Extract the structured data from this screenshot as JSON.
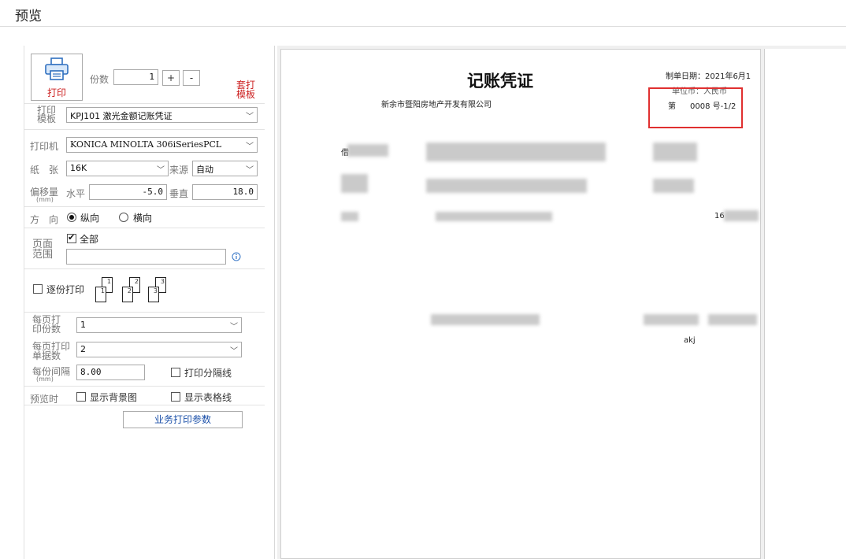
{
  "window": {
    "title": "预览"
  },
  "print_panel": {
    "print_button_label": "打印",
    "copies_label": "份数",
    "copies_value": "1",
    "plus_label": "+",
    "minus_label": "-",
    "template_stamp": "套打\n模板",
    "template_label": "打印\n模板",
    "template_value": "KPJ101 激光金额记账凭证",
    "printer_label": "打印机",
    "printer_value": "KONICA MINOLTA 306iSeriesPCL",
    "paper_label": "纸　张",
    "paper_value": "16K",
    "source_label": "来源",
    "source_value": "自动",
    "offset_label": "偏移量",
    "offset_unit": "(mm)",
    "horizontal_label": "水平",
    "horizontal_value": "-5.0",
    "vertical_label": "垂直",
    "vertical_value": "18.0",
    "orientation_label": "方　向",
    "portrait_label": "纵向",
    "landscape_label": "横向",
    "page_range_label": "页面\n范围",
    "all_label": "全部",
    "page_range_value": "",
    "collate_label": "逐份打印",
    "collate_pages": [
      "1",
      "1",
      "2",
      "2",
      "3",
      "3"
    ],
    "copies_per_page_label": "每页打\n印份数",
    "copies_per_page_value": "1",
    "docs_per_page_label": "每页打印\n单据数",
    "docs_per_page_value": "2",
    "interval_label": "每份间隔",
    "interval_unit": "(mm)",
    "interval_value": "8.00",
    "separator_label": "打印分隔线",
    "preview_label": "预览时",
    "show_bg_label": "显示背景图",
    "show_grid_label": "显示表格线",
    "biz_params_button": "业务打印参数"
  },
  "voucher": {
    "title": "记账凭证",
    "company": "新余市暨阳房地产开发有限公司",
    "date_line": "制单日期：2021年6月1",
    "currency_line": "单位币：人民币",
    "number_prefix": "第",
    "number_value": "0008 号-1/2",
    "row_fragment_1": "借",
    "row_fragment_2": "16",
    "maker": "akj"
  },
  "colors": {
    "accent": "#3a78c7",
    "red": "#cc2020",
    "highlight": "#e03030"
  }
}
